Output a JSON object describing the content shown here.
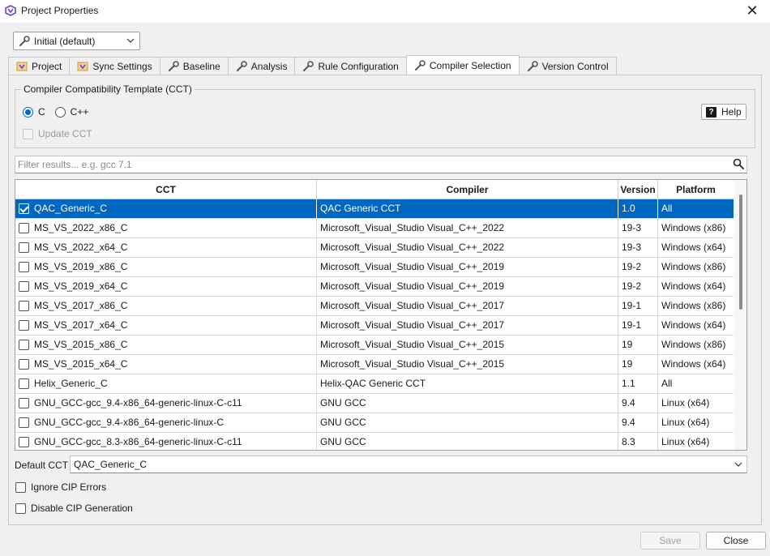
{
  "window": {
    "title": "Project Properties",
    "close_glyph": "✕"
  },
  "config": {
    "selected": "Initial (default)"
  },
  "tabs": [
    {
      "label": "Project",
      "icon": "project-icon",
      "active": false
    },
    {
      "label": "Sync Settings",
      "icon": "sync-settings-icon",
      "active": false
    },
    {
      "label": "Baseline",
      "icon": "wrench-icon",
      "active": false
    },
    {
      "label": "Analysis",
      "icon": "wrench-icon",
      "active": false
    },
    {
      "label": "Rule Configuration",
      "icon": "wrench-icon",
      "active": false
    },
    {
      "label": "Compiler Selection",
      "icon": "wrench-icon",
      "active": true
    },
    {
      "label": "Version Control",
      "icon": "wrench-icon",
      "active": false
    }
  ],
  "cct_group": {
    "title": "Compiler Compatibility Template (CCT)",
    "language_options": [
      "C",
      "C++"
    ],
    "selected_language": "C",
    "update_cct_label": "Update CCT",
    "update_cct_checked": false,
    "help_label": "Help",
    "help_glyph": "?"
  },
  "filter": {
    "placeholder": "Filter results... e.g. gcc 7.1"
  },
  "table": {
    "headers": [
      "CCT",
      "Compiler",
      "Version",
      "Platform"
    ],
    "rows": [
      {
        "cct": "QAC_Generic_C",
        "compiler": "QAC Generic CCT",
        "version": "1.0",
        "platform": "All",
        "checked": true,
        "selected": true
      },
      {
        "cct": "MS_VS_2022_x86_C",
        "compiler": "Microsoft_Visual_Studio Visual_C++_2022",
        "version": "19-3",
        "platform": "Windows (x86)",
        "checked": false,
        "selected": false
      },
      {
        "cct": "MS_VS_2022_x64_C",
        "compiler": "Microsoft_Visual_Studio Visual_C++_2022",
        "version": "19-3",
        "platform": "Windows (x64)",
        "checked": false,
        "selected": false
      },
      {
        "cct": "MS_VS_2019_x86_C",
        "compiler": "Microsoft_Visual_Studio Visual_C++_2019",
        "version": "19-2",
        "platform": "Windows (x86)",
        "checked": false,
        "selected": false
      },
      {
        "cct": "MS_VS_2019_x64_C",
        "compiler": "Microsoft_Visual_Studio Visual_C++_2019",
        "version": "19-2",
        "platform": "Windows (x64)",
        "checked": false,
        "selected": false
      },
      {
        "cct": "MS_VS_2017_x86_C",
        "compiler": "Microsoft_Visual_Studio Visual_C++_2017",
        "version": "19-1",
        "platform": "Windows (x86)",
        "checked": false,
        "selected": false
      },
      {
        "cct": "MS_VS_2017_x64_C",
        "compiler": "Microsoft_Visual_Studio Visual_C++_2017",
        "version": "19-1",
        "platform": "Windows (x64)",
        "checked": false,
        "selected": false
      },
      {
        "cct": "MS_VS_2015_x86_C",
        "compiler": "Microsoft_Visual_Studio Visual_C++_2015",
        "version": "19",
        "platform": "Windows (x86)",
        "checked": false,
        "selected": false
      },
      {
        "cct": "MS_VS_2015_x64_C",
        "compiler": "Microsoft_Visual_Studio Visual_C++_2015",
        "version": "19",
        "platform": "Windows (x64)",
        "checked": false,
        "selected": false
      },
      {
        "cct": "Helix_Generic_C",
        "compiler": "Helix-QAC Generic CCT",
        "version": "1.1",
        "platform": "All",
        "checked": false,
        "selected": false
      },
      {
        "cct": "GNU_GCC-gcc_9.4-x86_64-generic-linux-C-c11",
        "compiler": "GNU GCC",
        "version": "9.4",
        "platform": "Linux (x64)",
        "checked": false,
        "selected": false
      },
      {
        "cct": "GNU_GCC-gcc_9.4-x86_64-generic-linux-C",
        "compiler": "GNU GCC",
        "version": "9.4",
        "platform": "Linux (x64)",
        "checked": false,
        "selected": false
      },
      {
        "cct": "GNU_GCC-gcc_8.3-x86_64-generic-linux-C-c11",
        "compiler": "GNU GCC",
        "version": "8.3",
        "platform": "Linux (x64)",
        "checked": false,
        "selected": false
      }
    ]
  },
  "default_cct": {
    "label": "Default CCT",
    "value": "QAC_Generic_C"
  },
  "options": {
    "ignore_cip_errors": {
      "label": "Ignore CIP Errors",
      "checked": false
    },
    "disable_cip_generation": {
      "label": "Disable CIP Generation",
      "checked": false
    }
  },
  "buttons": {
    "save": "Save",
    "close": "Close"
  },
  "colors": {
    "accent": "#0067c0",
    "app_icon": "#6e3fd0"
  }
}
